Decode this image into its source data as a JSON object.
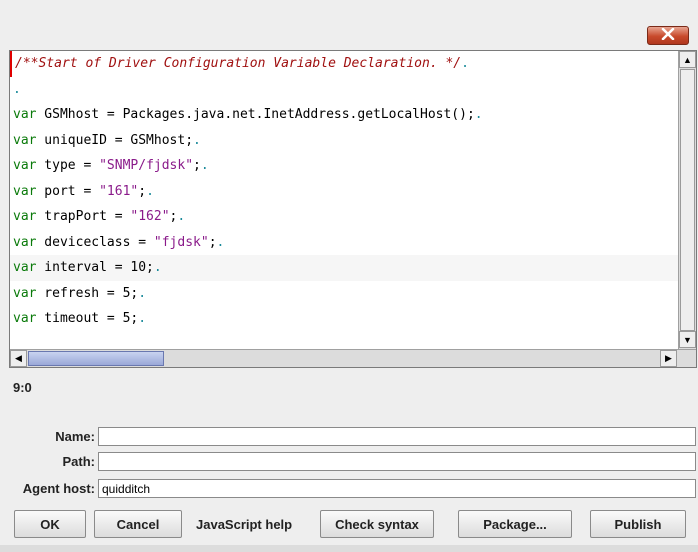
{
  "window": {
    "close_icon": "close-x-icon"
  },
  "editor": {
    "lines": [
      [
        {
          "t": "/**Start of Driver Configuration Variable Declaration. */",
          "c": "comment"
        },
        {
          "t": ".",
          "c": "ws"
        }
      ],
      [
        {
          "t": ".",
          "c": "ws"
        }
      ],
      [
        {
          "t": "var",
          "c": "kw"
        },
        {
          "t": " GSMhost = Packages.java.net.InetAddress.getLocalHost();",
          "c": ""
        },
        {
          "t": ".",
          "c": "ws"
        }
      ],
      [
        {
          "t": "var",
          "c": "kw"
        },
        {
          "t": " uniqueID = GSMhost;",
          "c": ""
        },
        {
          "t": ".",
          "c": "ws"
        }
      ],
      [
        {
          "t": "var",
          "c": "kw"
        },
        {
          "t": " type = ",
          "c": ""
        },
        {
          "t": "\"SNMP/fjdsk\"",
          "c": "str"
        },
        {
          "t": ";",
          "c": ""
        },
        {
          "t": ".",
          "c": "ws"
        }
      ],
      [
        {
          "t": "var",
          "c": "kw"
        },
        {
          "t": " port = ",
          "c": ""
        },
        {
          "t": "\"161\"",
          "c": "str"
        },
        {
          "t": ";",
          "c": ""
        },
        {
          "t": ".",
          "c": "ws"
        }
      ],
      [
        {
          "t": "var",
          "c": "kw"
        },
        {
          "t": " trapPort = ",
          "c": ""
        },
        {
          "t": "\"162\"",
          "c": "str"
        },
        {
          "t": ";",
          "c": ""
        },
        {
          "t": ".",
          "c": "ws"
        }
      ],
      [
        {
          "t": "var",
          "c": "kw"
        },
        {
          "t": " deviceclass = ",
          "c": ""
        },
        {
          "t": "\"fjdsk\"",
          "c": "str"
        },
        {
          "t": ";",
          "c": ""
        },
        {
          "t": ".",
          "c": "ws"
        }
      ],
      [
        {
          "t": "var",
          "c": "kw"
        },
        {
          "t": " interval = 10;",
          "c": ""
        },
        {
          "t": ".",
          "c": "ws"
        }
      ],
      [
        {
          "t": "var",
          "c": "kw"
        },
        {
          "t": " refresh = 5;",
          "c": ""
        },
        {
          "t": ".",
          "c": "ws"
        }
      ],
      [
        {
          "t": "var",
          "c": "kw"
        },
        {
          "t": " timeout = 5;",
          "c": ""
        },
        {
          "t": ".",
          "c": "ws"
        }
      ]
    ],
    "highlight_line_index": 8
  },
  "status": {
    "cursor_position": "9:0"
  },
  "form": {
    "name_label": "Name:",
    "name_value": "",
    "path_label": "Path:",
    "path_value": "",
    "agent_host_label": "Agent host:",
    "agent_host_value": "quidditch"
  },
  "buttons": {
    "ok": "OK",
    "cancel": "Cancel",
    "js_help": "JavaScript help",
    "check_syntax": "Check syntax",
    "package": "Package...",
    "publish": "Publish"
  },
  "colors": {
    "close_button": "#c84a2c",
    "keyword": "#0a7a0a",
    "string": "#8a1a8a",
    "comment": "#a01010",
    "whitespace_marker": "#1a8a9a"
  }
}
